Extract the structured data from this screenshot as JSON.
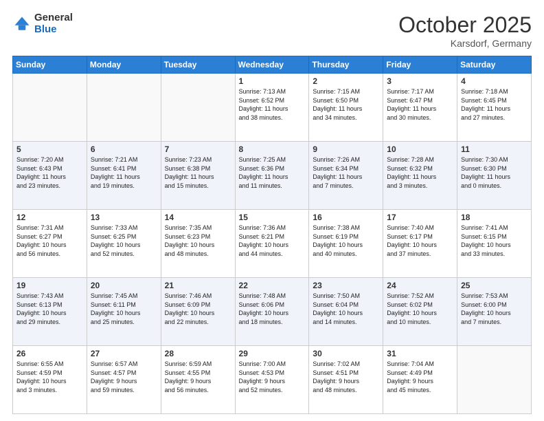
{
  "logo": {
    "general": "General",
    "blue": "Blue"
  },
  "title": "October 2025",
  "location": "Karsdorf, Germany",
  "days_header": [
    "Sunday",
    "Monday",
    "Tuesday",
    "Wednesday",
    "Thursday",
    "Friday",
    "Saturday"
  ],
  "weeks": [
    [
      {
        "day": "",
        "info": ""
      },
      {
        "day": "",
        "info": ""
      },
      {
        "day": "",
        "info": ""
      },
      {
        "day": "1",
        "info": "Sunrise: 7:13 AM\nSunset: 6:52 PM\nDaylight: 11 hours\nand 38 minutes."
      },
      {
        "day": "2",
        "info": "Sunrise: 7:15 AM\nSunset: 6:50 PM\nDaylight: 11 hours\nand 34 minutes."
      },
      {
        "day": "3",
        "info": "Sunrise: 7:17 AM\nSunset: 6:47 PM\nDaylight: 11 hours\nand 30 minutes."
      },
      {
        "day": "4",
        "info": "Sunrise: 7:18 AM\nSunset: 6:45 PM\nDaylight: 11 hours\nand 27 minutes."
      }
    ],
    [
      {
        "day": "5",
        "info": "Sunrise: 7:20 AM\nSunset: 6:43 PM\nDaylight: 11 hours\nand 23 minutes."
      },
      {
        "day": "6",
        "info": "Sunrise: 7:21 AM\nSunset: 6:41 PM\nDaylight: 11 hours\nand 19 minutes."
      },
      {
        "day": "7",
        "info": "Sunrise: 7:23 AM\nSunset: 6:38 PM\nDaylight: 11 hours\nand 15 minutes."
      },
      {
        "day": "8",
        "info": "Sunrise: 7:25 AM\nSunset: 6:36 PM\nDaylight: 11 hours\nand 11 minutes."
      },
      {
        "day": "9",
        "info": "Sunrise: 7:26 AM\nSunset: 6:34 PM\nDaylight: 11 hours\nand 7 minutes."
      },
      {
        "day": "10",
        "info": "Sunrise: 7:28 AM\nSunset: 6:32 PM\nDaylight: 11 hours\nand 3 minutes."
      },
      {
        "day": "11",
        "info": "Sunrise: 7:30 AM\nSunset: 6:30 PM\nDaylight: 11 hours\nand 0 minutes."
      }
    ],
    [
      {
        "day": "12",
        "info": "Sunrise: 7:31 AM\nSunset: 6:27 PM\nDaylight: 10 hours\nand 56 minutes."
      },
      {
        "day": "13",
        "info": "Sunrise: 7:33 AM\nSunset: 6:25 PM\nDaylight: 10 hours\nand 52 minutes."
      },
      {
        "day": "14",
        "info": "Sunrise: 7:35 AM\nSunset: 6:23 PM\nDaylight: 10 hours\nand 48 minutes."
      },
      {
        "day": "15",
        "info": "Sunrise: 7:36 AM\nSunset: 6:21 PM\nDaylight: 10 hours\nand 44 minutes."
      },
      {
        "day": "16",
        "info": "Sunrise: 7:38 AM\nSunset: 6:19 PM\nDaylight: 10 hours\nand 40 minutes."
      },
      {
        "day": "17",
        "info": "Sunrise: 7:40 AM\nSunset: 6:17 PM\nDaylight: 10 hours\nand 37 minutes."
      },
      {
        "day": "18",
        "info": "Sunrise: 7:41 AM\nSunset: 6:15 PM\nDaylight: 10 hours\nand 33 minutes."
      }
    ],
    [
      {
        "day": "19",
        "info": "Sunrise: 7:43 AM\nSunset: 6:13 PM\nDaylight: 10 hours\nand 29 minutes."
      },
      {
        "day": "20",
        "info": "Sunrise: 7:45 AM\nSunset: 6:11 PM\nDaylight: 10 hours\nand 25 minutes."
      },
      {
        "day": "21",
        "info": "Sunrise: 7:46 AM\nSunset: 6:09 PM\nDaylight: 10 hours\nand 22 minutes."
      },
      {
        "day": "22",
        "info": "Sunrise: 7:48 AM\nSunset: 6:06 PM\nDaylight: 10 hours\nand 18 minutes."
      },
      {
        "day": "23",
        "info": "Sunrise: 7:50 AM\nSunset: 6:04 PM\nDaylight: 10 hours\nand 14 minutes."
      },
      {
        "day": "24",
        "info": "Sunrise: 7:52 AM\nSunset: 6:02 PM\nDaylight: 10 hours\nand 10 minutes."
      },
      {
        "day": "25",
        "info": "Sunrise: 7:53 AM\nSunset: 6:00 PM\nDaylight: 10 hours\nand 7 minutes."
      }
    ],
    [
      {
        "day": "26",
        "info": "Sunrise: 6:55 AM\nSunset: 4:59 PM\nDaylight: 10 hours\nand 3 minutes."
      },
      {
        "day": "27",
        "info": "Sunrise: 6:57 AM\nSunset: 4:57 PM\nDaylight: 9 hours\nand 59 minutes."
      },
      {
        "day": "28",
        "info": "Sunrise: 6:59 AM\nSunset: 4:55 PM\nDaylight: 9 hours\nand 56 minutes."
      },
      {
        "day": "29",
        "info": "Sunrise: 7:00 AM\nSunset: 4:53 PM\nDaylight: 9 hours\nand 52 minutes."
      },
      {
        "day": "30",
        "info": "Sunrise: 7:02 AM\nSunset: 4:51 PM\nDaylight: 9 hours\nand 48 minutes."
      },
      {
        "day": "31",
        "info": "Sunrise: 7:04 AM\nSunset: 4:49 PM\nDaylight: 9 hours\nand 45 minutes."
      },
      {
        "day": "",
        "info": ""
      }
    ]
  ]
}
